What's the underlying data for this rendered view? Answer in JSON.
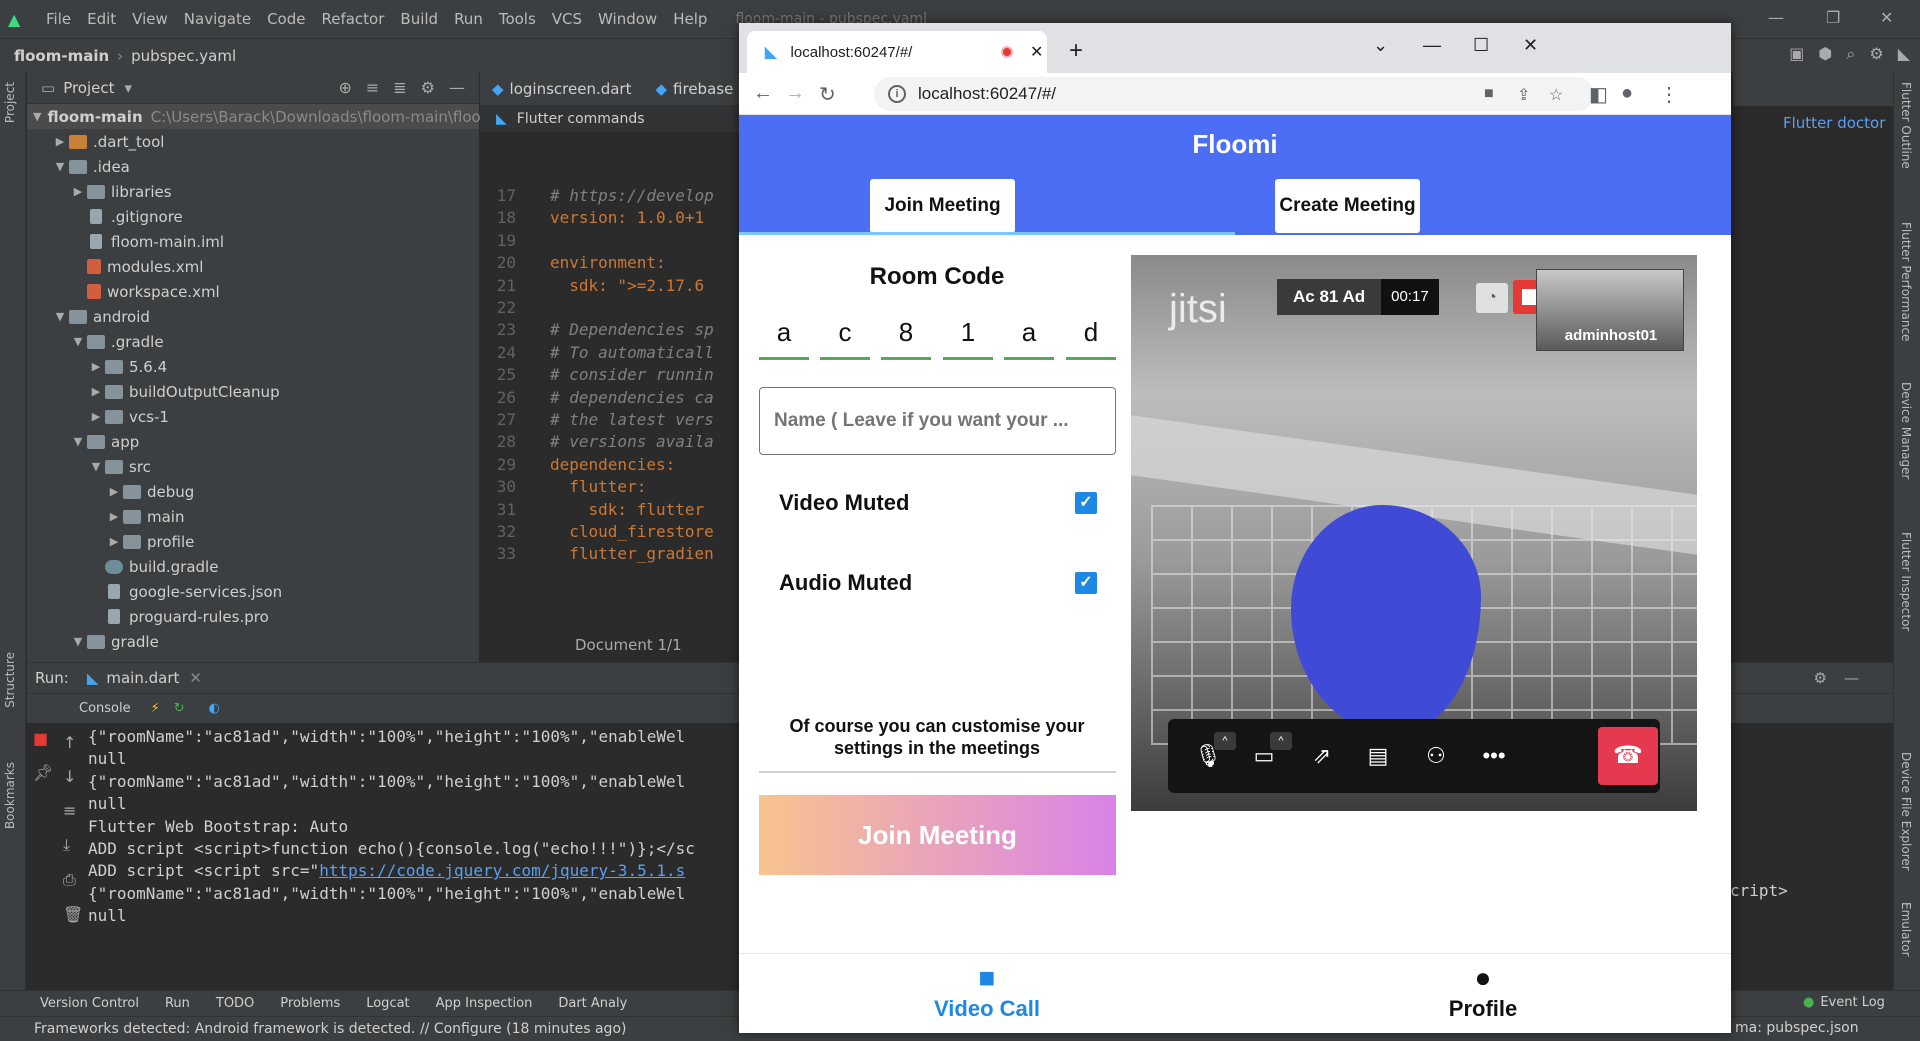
{
  "ide": {
    "menu": [
      "File",
      "Edit",
      "View",
      "Navigate",
      "Code",
      "Refactor",
      "Build",
      "Run",
      "Tools",
      "VCS",
      "Window",
      "Help"
    ],
    "window_title": "floom-main - pubspec.yaml",
    "breadcrumb": {
      "project": "floom-main",
      "file": "pubspec.yaml"
    },
    "project_panel": {
      "title": "Project",
      "tree": [
        {
          "label": "floom-main",
          "path": "C:\\Users\\Barack\\Downloads\\floom-main\\floo",
          "indent": 0,
          "arrow": "open",
          "icon": "folder"
        },
        {
          "label": ".dart_tool",
          "indent": 1,
          "arrow": "closed",
          "icon": "orange"
        },
        {
          "label": ".idea",
          "indent": 1,
          "arrow": "open",
          "icon": "folder"
        },
        {
          "label": "libraries",
          "indent": 2,
          "arrow": "closed",
          "icon": "folder"
        },
        {
          "label": ".gitignore",
          "indent": 2,
          "arrow": "none",
          "icon": "file"
        },
        {
          "label": "floom-main.iml",
          "indent": 2,
          "arrow": "none",
          "icon": "file"
        },
        {
          "label": "modules.xml",
          "indent": 2,
          "arrow": "none",
          "icon": "xml"
        },
        {
          "label": "workspace.xml",
          "indent": 2,
          "arrow": "none",
          "icon": "xml"
        },
        {
          "label": "android",
          "indent": 1,
          "arrow": "open",
          "icon": "folder"
        },
        {
          "label": ".gradle",
          "indent": 2,
          "arrow": "open",
          "icon": "folder"
        },
        {
          "label": "5.6.4",
          "indent": 3,
          "arrow": "closed",
          "icon": "folder"
        },
        {
          "label": "buildOutputCleanup",
          "indent": 3,
          "arrow": "closed",
          "icon": "folder"
        },
        {
          "label": "vcs-1",
          "indent": 3,
          "arrow": "closed",
          "icon": "folder"
        },
        {
          "label": "app",
          "indent": 2,
          "arrow": "open",
          "icon": "folder"
        },
        {
          "label": "src",
          "indent": 3,
          "arrow": "open",
          "icon": "folder"
        },
        {
          "label": "debug",
          "indent": 4,
          "arrow": "closed",
          "icon": "folder"
        },
        {
          "label": "main",
          "indent": 4,
          "arrow": "closed",
          "icon": "folder"
        },
        {
          "label": "profile",
          "indent": 4,
          "arrow": "closed",
          "icon": "folder"
        },
        {
          "label": "build.gradle",
          "indent": 3,
          "arrow": "none",
          "icon": "gradle"
        },
        {
          "label": "google-services.json",
          "indent": 3,
          "arrow": "none",
          "icon": "file"
        },
        {
          "label": "proguard-rules.pro",
          "indent": 3,
          "arrow": "none",
          "icon": "file"
        },
        {
          "label": "gradle",
          "indent": 2,
          "arrow": "open",
          "icon": "folder"
        }
      ]
    },
    "editor_tabs": [
      "loginscreen.dart",
      "firebase"
    ],
    "flutter_commands": "Flutter commands",
    "code_lines": [
      {
        "n": "17",
        "text": "# https://develop",
        "cls": "comment"
      },
      {
        "n": "18",
        "text": "version: 1.0.0+1",
        "cls": "key"
      },
      {
        "n": "19",
        "text": "",
        "cls": "plain"
      },
      {
        "n": "20",
        "text": "environment:",
        "cls": "key"
      },
      {
        "n": "21",
        "text": "  sdk: \">=2.17.6",
        "cls": "key"
      },
      {
        "n": "22",
        "text": "",
        "cls": "plain"
      },
      {
        "n": "23",
        "text": "# Dependencies sp",
        "cls": "comment"
      },
      {
        "n": "24",
        "text": "# To automaticall",
        "cls": "comment"
      },
      {
        "n": "25",
        "text": "# consider runnin",
        "cls": "comment"
      },
      {
        "n": "26",
        "text": "# dependencies ca",
        "cls": "comment"
      },
      {
        "n": "27",
        "text": "# the latest vers",
        "cls": "comment"
      },
      {
        "n": "28",
        "text": "# versions availa",
        "cls": "comment"
      },
      {
        "n": "29",
        "text": "dependencies:",
        "cls": "key"
      },
      {
        "n": "30",
        "text": "  flutter:",
        "cls": "key"
      },
      {
        "n": "31",
        "text": "    sdk: flutter",
        "cls": "key"
      },
      {
        "n": "32",
        "text": "  cloud_firestore",
        "cls": "key"
      },
      {
        "n": "33",
        "text": "  flutter_gradien",
        "cls": "key"
      }
    ],
    "doc_status": "Document 1/1",
    "flutter_doctor": "Flutter doctor",
    "run_panel": {
      "title": "Run:",
      "config": "main.dart",
      "console_tab": "Console",
      "lines": [
        {
          "text": "{\"roomName\":\"ac81ad\",\"width\":\"100%\",\"height\":\"100%\",\"enableWel"
        },
        {
          "text": "null"
        },
        {
          "text": "{\"roomName\":\"ac81ad\",\"width\":\"100%\",\"height\":\"100%\",\"enableWel"
        },
        {
          "text": "null"
        },
        {
          "text": "Flutter Web Bootstrap: Auto"
        },
        {
          "text": "ADD script <script>function echo(){console.log(\"echo!!!\")};</sc"
        },
        {
          "text": "ADD script <script src=\"",
          "link": "https://code.jquery.com/jquery-3.5.1.s"
        },
        {
          "text": "{\"roomName\":\"ac81ad\",\"width\":\"100%\",\"height\":\"100%\",\"enableWel"
        },
        {
          "text": "null"
        }
      ],
      "tail": "cript>"
    },
    "bottom_tools": [
      "Version Control",
      "Run",
      "TODO",
      "Problems",
      "Logcat",
      "App Inspection",
      "Dart Analy"
    ],
    "event_log": "Event Log",
    "status_message": "Frameworks detected: Android framework is detected. // Configure (18 minutes ago)",
    "schema": "ma: pubspec.json",
    "left_vertical_tabs": [
      "Project",
      "Structure",
      "Bookmarks"
    ],
    "right_vertical_tabs": [
      "Flutter Outline",
      "Flutter Performance",
      "Device Manager",
      "Flutter Inspector",
      "Device File Explorer",
      "Emulator"
    ]
  },
  "browser": {
    "tab_title": "localhost:60247/#/",
    "url": "localhost:60247/#/"
  },
  "app": {
    "title": "Floomi",
    "top_tabs": [
      "Join Meeting",
      "Create Meeting"
    ],
    "room_code_title": "Room Code",
    "room_code": [
      "a",
      "c",
      "8",
      "1",
      "a",
      "d"
    ],
    "name_placeholder": "Name ( Leave if you want your ...",
    "video_muted_label": "Video Muted",
    "video_muted": true,
    "audio_muted_label": "Audio Muted",
    "audio_muted": true,
    "customise_note": "Of course you can customise your settings in the meetings",
    "join_button": "Join Meeting",
    "meeting": {
      "logo": "jitsi",
      "name": "Ac 81 Ad",
      "elapsed": "00:17",
      "participant": "adminhost01"
    },
    "bottom_nav": [
      {
        "label": "Video Call",
        "icon": "video-call-icon",
        "color": "#1e88e5"
      },
      {
        "label": "Profile",
        "icon": "person-icon",
        "color": "#111111"
      }
    ]
  }
}
